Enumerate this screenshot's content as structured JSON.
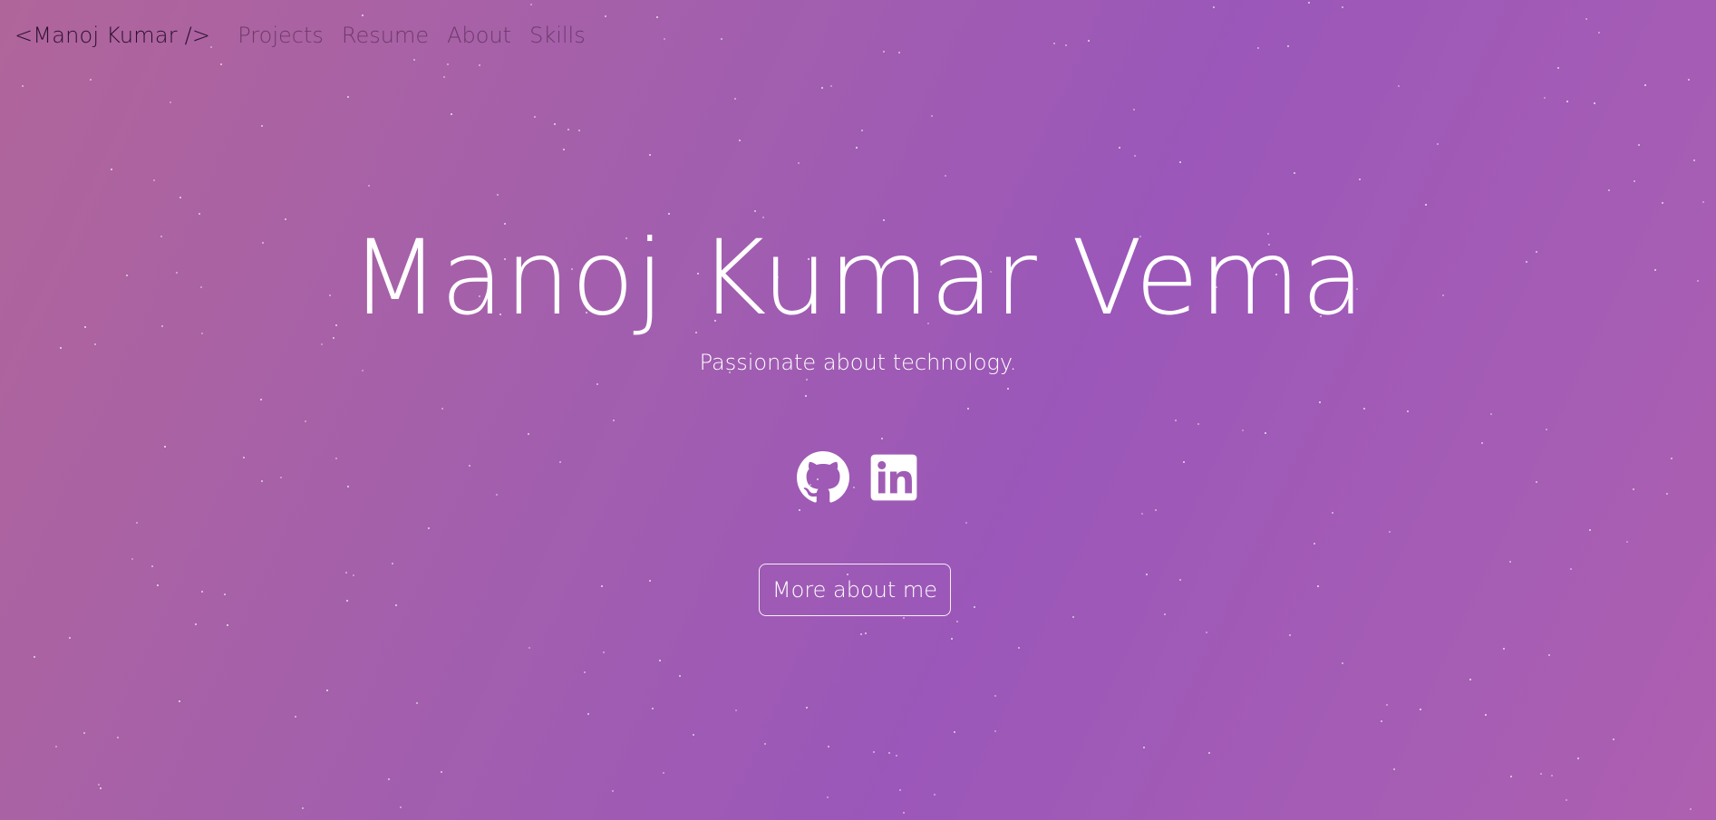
{
  "nav": {
    "brand": "<Manoj Kumar />",
    "links": [
      {
        "label": "Projects"
      },
      {
        "label": "Resume"
      },
      {
        "label": "About"
      },
      {
        "label": "Skills"
      }
    ]
  },
  "hero": {
    "title": "Manoj Kumar Vema",
    "subtitle": "Passionate about technology.",
    "socials": [
      {
        "icon": "github-icon"
      },
      {
        "icon": "linkedin-icon"
      }
    ],
    "cta_label": "More about me"
  },
  "colors": {
    "gradient_start": "#b0659a",
    "gradient_mid": "#9b57b9",
    "text": "#ffffff",
    "brand_text": "#2a1030"
  }
}
